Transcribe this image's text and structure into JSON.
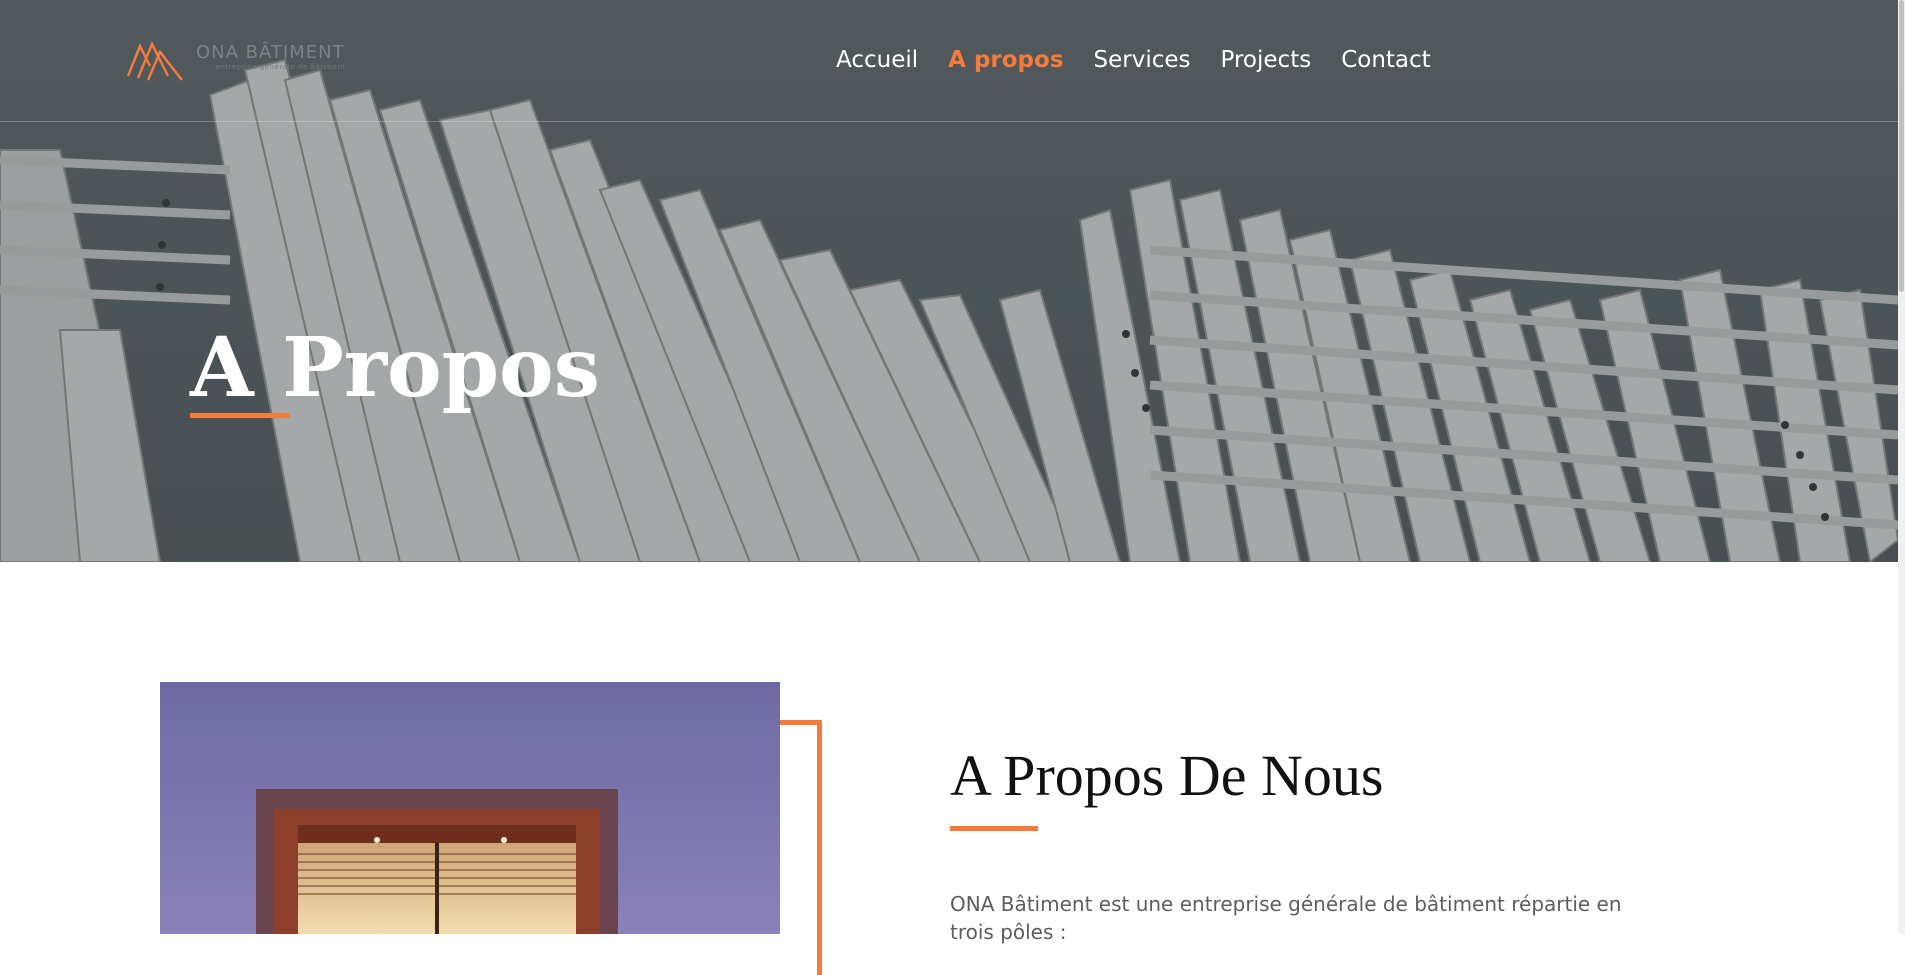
{
  "header": {
    "logo": {
      "name": "ONA BÂTIMENT",
      "tagline": "entreprise générale de bâtiment"
    },
    "nav": [
      {
        "label": "Accueil",
        "active": false
      },
      {
        "label": "A propos",
        "active": true
      },
      {
        "label": "Services",
        "active": false
      },
      {
        "label": "Projects",
        "active": false
      },
      {
        "label": "Contact",
        "active": false
      }
    ]
  },
  "hero": {
    "title": "A Propos"
  },
  "about": {
    "title": "A Propos De Nous",
    "text": "ONA Bâtiment est une entreprise générale de bâtiment répartie en trois pôles :"
  },
  "colors": {
    "accent": "#f47b3a",
    "overlay": "#555c60"
  }
}
